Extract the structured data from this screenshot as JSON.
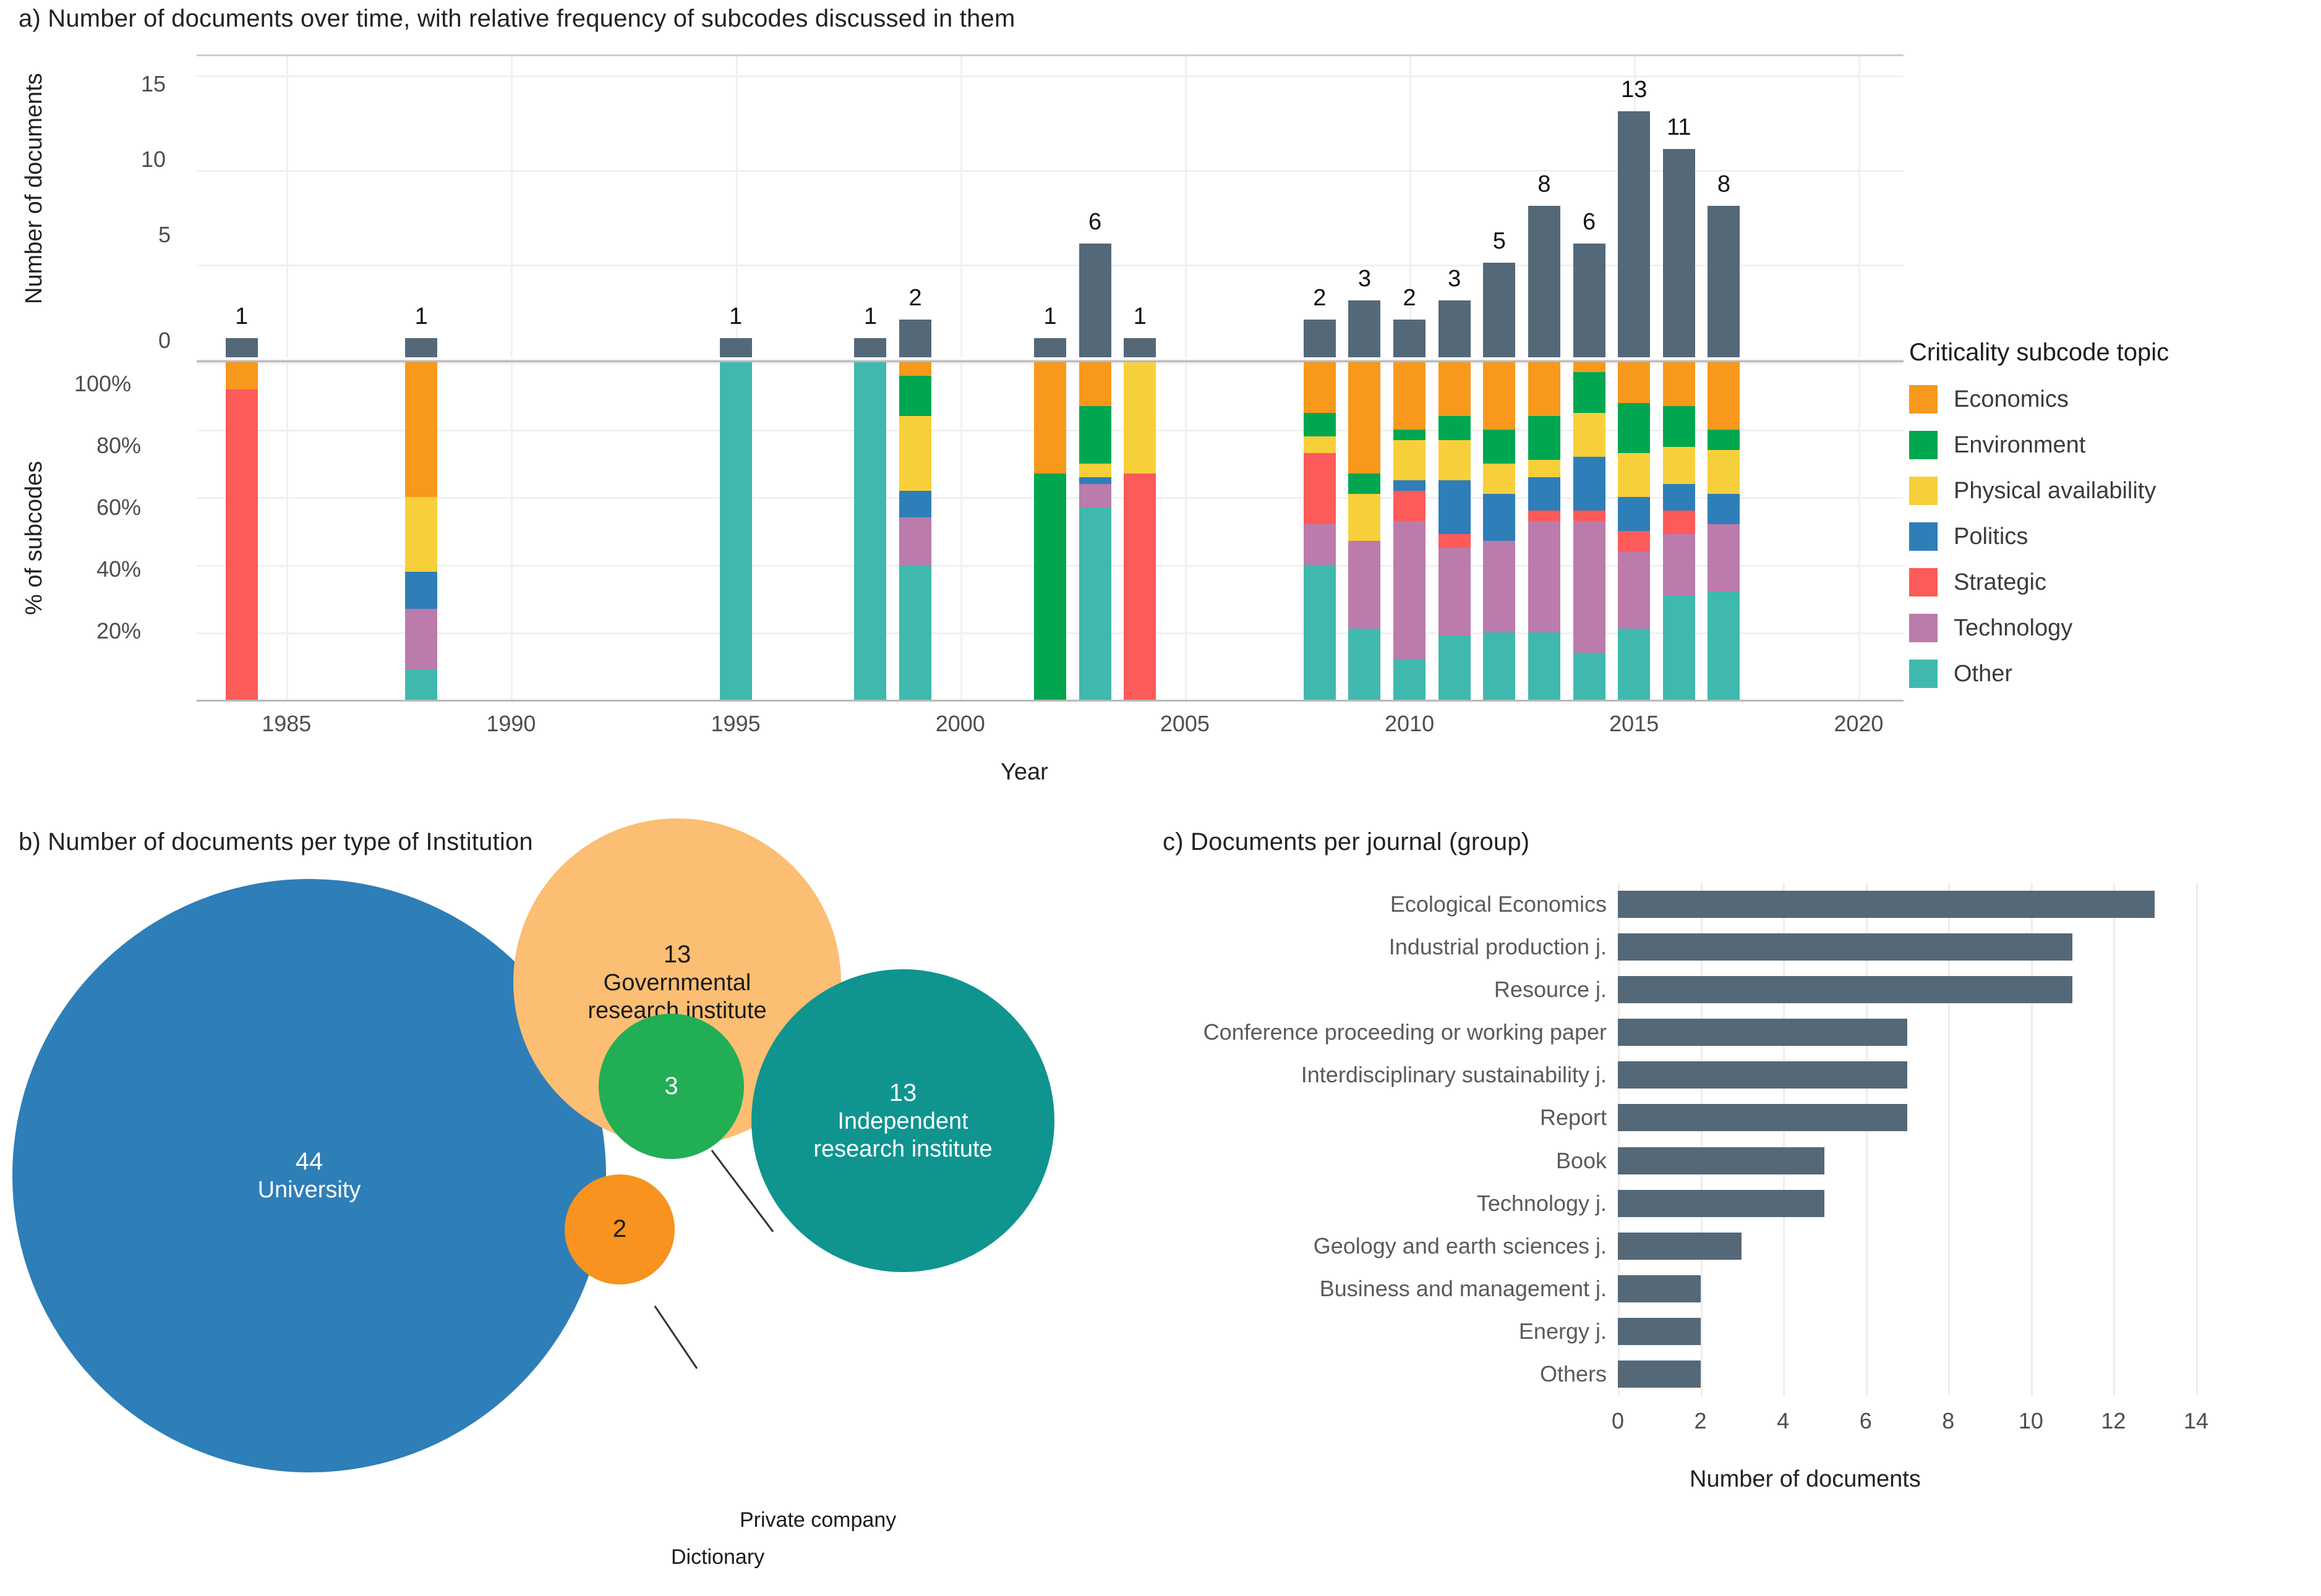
{
  "panel_a": {
    "title": "a) Number of documents over time, with relative frequency of subcodes discussed in them",
    "y_axis_top_label": "Number of documents",
    "y_axis_bottom_label": "% of subcodes",
    "x_axis_label": "Year",
    "y_ticks_top": [
      "15",
      "10",
      "5",
      "0"
    ],
    "y_ticks_bottom": [
      "100%",
      "80%",
      "60%",
      "40%",
      "20%"
    ],
    "x_ticks": [
      "1985",
      "1990",
      "1995",
      "2000",
      "2005",
      "2010",
      "2015",
      "2020"
    ]
  },
  "legend": {
    "title": "Criticality subcode topic",
    "items": [
      {
        "label": "Economics",
        "color": "#F8981D"
      },
      {
        "label": "Environment",
        "color": "#00A650"
      },
      {
        "label": "Physical availability",
        "color": "#F7CF3B"
      },
      {
        "label": "Politics",
        "color": "#2E7EB8"
      },
      {
        "label": "Strategic",
        "color": "#FD5A5A"
      },
      {
        "label": "Technology",
        "color": "#BB7BAB"
      },
      {
        "label": "Other",
        "color": "#3FB8AE"
      }
    ]
  },
  "panel_b": {
    "title": "b) Number of documents per type of Institution",
    "bubbles": [
      {
        "count": "44",
        "label": "University",
        "color": "#2E7EB8",
        "text_color": "#ffffff"
      },
      {
        "count": "13",
        "label": "Governmental\nresearch institute",
        "color": "#FBBE72",
        "text_color": "#1b1b1b"
      },
      {
        "count": "13",
        "label": "Independent\nresearch institute",
        "color": "#109490",
        "text_color": "#ffffff"
      },
      {
        "count": "3",
        "label": "",
        "color": "#22AE54",
        "text_color": "#ffffff"
      },
      {
        "count": "2",
        "label": "",
        "color": "#F7931E",
        "text_color": "#1b1b1b"
      }
    ],
    "callouts": [
      {
        "label": "Private company"
      },
      {
        "label": "Dictionary"
      }
    ]
  },
  "panel_c": {
    "title": "c) Documents per journal (group)",
    "x_axis_label": "Number of documents",
    "bar_color": "#546878"
  },
  "chart_data": [
    {
      "id": "a-top",
      "type": "bar",
      "title": "a) Number of documents over time, with relative frequency of subcodes discussed in them",
      "xlabel": "Year",
      "ylabel": "Number of documents",
      "xlim": [
        1983,
        2021
      ],
      "ylim": [
        0,
        16
      ],
      "yticks": [
        0,
        5,
        10,
        15
      ],
      "xticks": [
        1985,
        1990,
        1995,
        2000,
        2005,
        2010,
        2015,
        2020
      ],
      "grid": true,
      "categories": [
        1984,
        1988,
        1995,
        1998,
        1999,
        2002,
        2003,
        2004,
        2008,
        2009,
        2010,
        2011,
        2012,
        2013,
        2014,
        2015,
        2016,
        2017
      ],
      "values": [
        1,
        1,
        1,
        1,
        2,
        1,
        6,
        1,
        2,
        3,
        2,
        3,
        5,
        8,
        6,
        13,
        11,
        8
      ],
      "data_labels": [
        "1",
        "1",
        "1",
        "1",
        "2",
        "1",
        "6",
        "1",
        "2",
        "3",
        "2",
        "3",
        "5",
        "8",
        "6",
        "13",
        "11",
        "8"
      ]
    },
    {
      "id": "a-bottom",
      "type": "bar",
      "stacked": true,
      "normalized": true,
      "ylabel": "% of subcodes",
      "xlabel": "Year",
      "ylim": [
        0,
        100
      ],
      "yticks": [
        20,
        40,
        60,
        80,
        100
      ],
      "grid": true,
      "legend_position": "right",
      "categories": [
        1984,
        1988,
        1995,
        1998,
        1999,
        2002,
        2003,
        2004,
        2008,
        2009,
        2010,
        2011,
        2012,
        2013,
        2014,
        2015,
        2016,
        2017
      ],
      "series": [
        {
          "name": "Other",
          "color": "#3FB8AE",
          "values": [
            0,
            9,
            100,
            100,
            40,
            0,
            57,
            0,
            40,
            21,
            12,
            19,
            20,
            20,
            14,
            21,
            31,
            32
          ]
        },
        {
          "name": "Technology",
          "color": "#BB7BAB",
          "values": [
            0,
            18,
            0,
            0,
            14,
            0,
            7,
            0,
            12,
            26,
            41,
            26,
            27,
            33,
            39,
            23,
            18,
            20
          ]
        },
        {
          "name": "Strategic",
          "color": "#FD5A5A",
          "values": [
            92,
            0,
            0,
            0,
            0,
            0,
            0,
            67,
            21,
            0,
            9,
            4,
            0,
            3,
            3,
            6,
            7,
            0
          ]
        },
        {
          "name": "Politics",
          "color": "#2E7EB8",
          "values": [
            0,
            11,
            0,
            0,
            8,
            0,
            2,
            0,
            0,
            0,
            3,
            16,
            14,
            10,
            16,
            10,
            8,
            9
          ]
        },
        {
          "name": "Physical availability",
          "color": "#F7CF3B",
          "values": [
            0,
            22,
            0,
            0,
            22,
            0,
            4,
            33,
            5,
            14,
            12,
            12,
            9,
            5,
            13,
            13,
            11,
            13
          ]
        },
        {
          "name": "Environment",
          "color": "#00A650",
          "values": [
            0,
            0,
            0,
            0,
            12,
            67,
            17,
            0,
            7,
            6,
            3,
            7,
            10,
            13,
            12,
            15,
            12,
            6
          ]
        },
        {
          "name": "Economics",
          "color": "#F8981D",
          "values": [
            8,
            40,
            0,
            0,
            4,
            33,
            13,
            0,
            15,
            33,
            20,
            16,
            20,
            16,
            3,
            12,
            13,
            20
          ]
        }
      ]
    },
    {
      "id": "b",
      "type": "pie",
      "title": "b) Number of documents per type of Institution",
      "categories": [
        "University",
        "Governmental research institute",
        "Independent research institute",
        "Private company",
        "Dictionary"
      ],
      "values": [
        44,
        13,
        13,
        3,
        2
      ],
      "colors": [
        "#2E7EB8",
        "#FBBE72",
        "#109490",
        "#22AE54",
        "#F7931E"
      ]
    },
    {
      "id": "c",
      "type": "bar",
      "orientation": "horizontal",
      "title": "c) Documents per journal (group)",
      "xlabel": "Number of documents",
      "ylabel": "",
      "xlim": [
        0,
        14
      ],
      "xticks": [
        0,
        2,
        4,
        6,
        8,
        10,
        12,
        14
      ],
      "grid": true,
      "categories": [
        "Ecological Economics",
        "Industrial production j.",
        "Resource j.",
        "Conference proceeding or working paper",
        "Interdisciplinary sustainability j.",
        "Report",
        "Book",
        "Technology j.",
        "Geology and earth sciences j.",
        "Business and management j.",
        "Energy j.",
        "Others"
      ],
      "values": [
        13,
        11,
        11,
        7,
        7,
        7,
        5,
        5,
        3,
        2,
        2,
        2
      ]
    }
  ]
}
